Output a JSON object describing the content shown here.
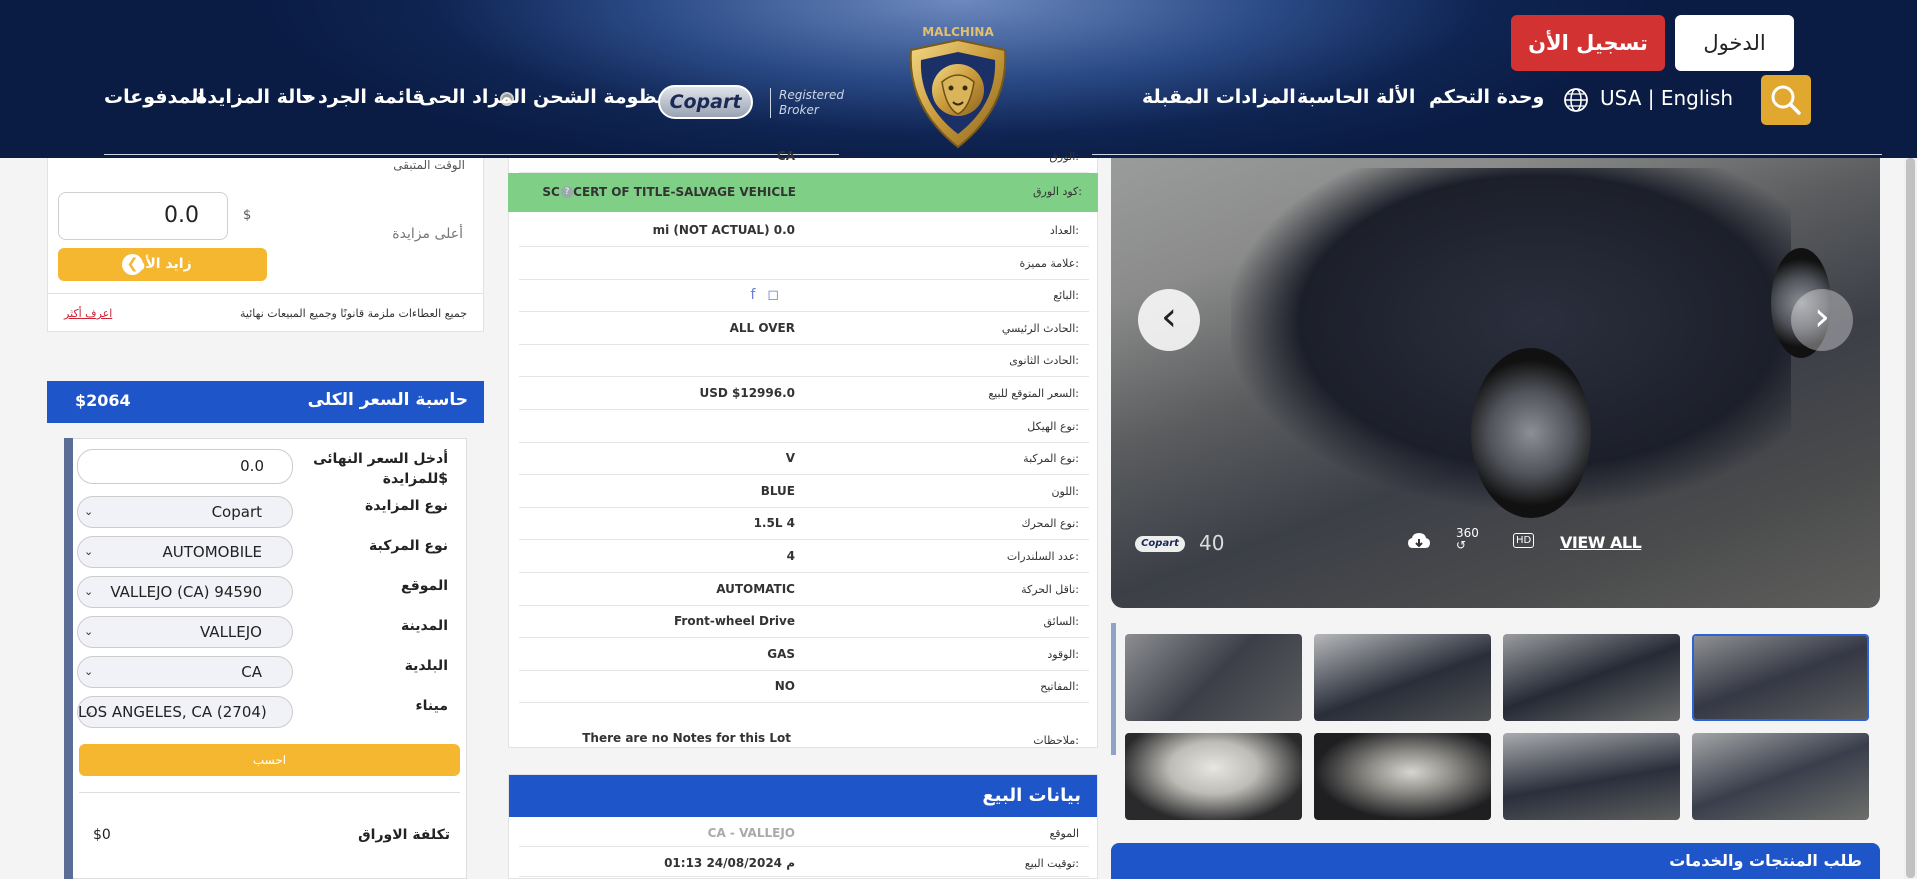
{
  "header": {
    "nav": {
      "payments": "المدفوعات",
      "auction_status": "حالة المزايدة",
      "inventory_list": "قائمة الجرد",
      "live_auction": "المزاد الحى",
      "shipping_system": "منظومة الشحن",
      "upcoming_auctions": "المزادات المقبلة",
      "calculator": "الألة الحاسبة",
      "dashboard": "وحدة التحكم"
    },
    "copart_label": "Copart",
    "broker_line1": "Registered",
    "broker_line2": "Broker",
    "logo_text": "MALCHINA",
    "language": "USA | English",
    "register_button": "تسجيل الأن",
    "login_button": "الدخول"
  },
  "bid": {
    "remaining_time_label": "الوقت المتبقى",
    "bid_value": "0.0",
    "currency": "$",
    "highest_bid_label": "أعلى مزايدة",
    "bid_now_label": "زايد الأن",
    "legal_text": "جميع العطاءات ملزمة قانونًا وجميع المبيعات نهائية",
    "learn_more": "اعرف أكثر"
  },
  "calculator": {
    "title": "حاسبة السعر الكلى",
    "total": "$2064",
    "final_price_label_line1": "أدخل السعر النهائى",
    "final_price_label_line2": "للمزايدة$",
    "final_price_value": "0.0",
    "auction_type_label": "نوع المزايدة",
    "auction_type_value": "Copart",
    "vehicle_type_label": "نوع المركبة",
    "vehicle_type_value": "AUTOMOBILE",
    "location_label": "الموقع",
    "location_value": "VALLEJO (CA) 94590",
    "city_label": "المدينة",
    "city_value": "VALLEJO",
    "state_label": "البلدية",
    "state_value": "CA",
    "port_label": "ميناء",
    "port_value": "LOS ANGELES, CA (2704)",
    "calculate_button": "احسب",
    "doc_cost_label": "تكلفة الاوراق",
    "doc_cost_value": "$0"
  },
  "details": {
    "top_partial_label": "الورق:",
    "top_partial_value": "CA",
    "title_code_label": "كود الورق:",
    "title_code_value": "SC - CERT OF TITLE-SALVAGE VEHICLE",
    "rows": [
      {
        "label": "العداد:",
        "value": "mi (NOT ACTUAL) 0.0"
      },
      {
        "label": "علامة مميزة:",
        "value": ""
      },
      {
        "label": "البائع:",
        "value": ""
      },
      {
        "label": "الحادث الرئيسي:",
        "value": "ALL OVER"
      },
      {
        "label": "الحادث الثانوى:",
        "value": ""
      },
      {
        "label": "السعر المتوقع للبيع:",
        "value": "USD $12996.0"
      },
      {
        "label": "نوع الهيكل:",
        "value": ""
      },
      {
        "label": "نوع المركبة:",
        "value": "V"
      },
      {
        "label": "اللون:",
        "value": "BLUE"
      },
      {
        "label": "نوع المحرك:",
        "value": "1.5L 4"
      },
      {
        "label": "عدد السلندرات:",
        "value": "4"
      },
      {
        "label": "ناقل الحركة:",
        "value": "AUTOMATIC"
      },
      {
        "label": "السائق:",
        "value": "Front-wheel Drive"
      },
      {
        "label": "الوقود:",
        "value": "GAS"
      },
      {
        "label": "المفاتيح:",
        "value": "NO"
      }
    ],
    "notes_label": "ملاحظات:",
    "notes_value": "There are no Notes for this Lot"
  },
  "sale": {
    "title": "بيانات البيع",
    "location_label": "الموقع",
    "location_value": "CA - VALLEJO",
    "sale_time_label": "توقيت البيع:",
    "sale_time_value": "01:13 24/08/2024 م"
  },
  "photo": {
    "copart_mini": "Copart",
    "forty": "40",
    "view_all": "VIEW ALL",
    "hd": "HD",
    "three_sixty": "360"
  },
  "services": {
    "title": "طلب المنتجات والخدمات"
  },
  "colors": {
    "header_dark": "#0f2452",
    "register_red": "#d33232",
    "accent_blue": "#1e55c9",
    "bid_orange": "#f5b730",
    "title_green": "#7fcf86",
    "search_gold": "#e0a82e"
  },
  "icons": [
    "search-icon",
    "globe-icon",
    "lion-logo",
    "facebook-icon",
    "instagram-icon",
    "cloud-download-icon",
    "hd-icon",
    "rotate-360-icon",
    "chevron-left-icon",
    "chevron-right-icon",
    "arrow-left-icon",
    "help-icon"
  ]
}
